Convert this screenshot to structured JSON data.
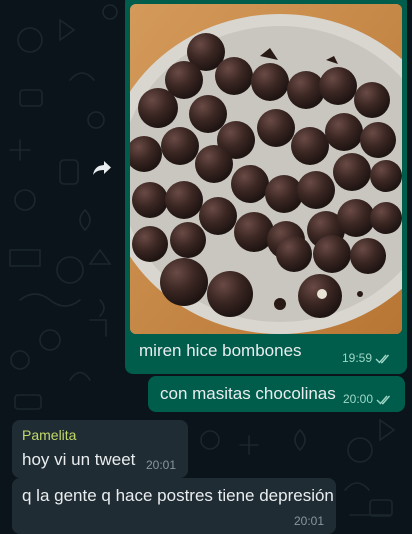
{
  "chat": {
    "messages": [
      {
        "direction": "outgoing",
        "type": "image",
        "image_subject": "chocolate bonbons on a glass plate",
        "caption": "miren hice bombones",
        "time": "19:59",
        "status": "read"
      },
      {
        "direction": "outgoing",
        "type": "text",
        "text": "con masitas chocolinas",
        "time": "20:00",
        "status": "read"
      },
      {
        "direction": "incoming",
        "type": "text",
        "sender": "Pamelita",
        "text": "hoy vi un tweet",
        "time": "20:01"
      },
      {
        "direction": "incoming",
        "type": "text",
        "text": "q la gente q hace postres tiene depresión",
        "time": "20:01"
      }
    ]
  },
  "icons": {
    "forward": "forward-arrow-icon",
    "read_receipt": "double-check-icon"
  },
  "colors": {
    "background": "#0b141a",
    "outgoing_bubble": "#005c4b",
    "incoming_bubble": "#202c33",
    "sender_name": "#c2d96a",
    "text": "#e9edef",
    "meta_outgoing": "#9fd6c6",
    "meta_incoming": "#8696a0"
  }
}
